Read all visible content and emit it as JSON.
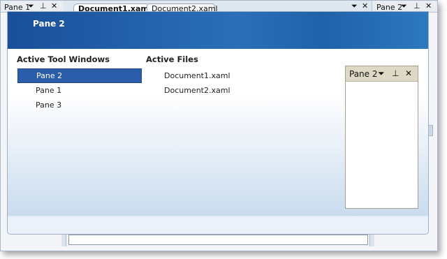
{
  "ide": {
    "left_tool": {
      "title": "Pane 1",
      "dropdown": "⏷",
      "pin": "⊥",
      "close": "✕"
    },
    "doc_tabs": [
      {
        "label": "Document1.xaml",
        "active": true
      },
      {
        "label": "Document2.xaml",
        "active": false
      }
    ],
    "tab_menu": "⏷",
    "tab_close": "✕",
    "right_tool": {
      "title": "Pane 2",
      "dropdown": "⏷",
      "pin": "⊥",
      "close": "✕"
    }
  },
  "navigator": {
    "title": "Pane 2",
    "tool_windows": {
      "heading": "Active Tool Windows",
      "items": [
        "Pane 2",
        "Pane 1",
        "Pane 3"
      ],
      "selected_index": 0
    },
    "files": {
      "heading": "Active Files",
      "items": [
        "Document1.xaml",
        "Document2.xaml"
      ]
    },
    "preview": {
      "title": "Pane 2",
      "dropdown": "⏷",
      "pin": "⊥",
      "close": "✕"
    }
  },
  "colors": {
    "header_blue": "#1a4f9a",
    "selection_blue": "#2c5daa",
    "preview_header": "#ded9c6"
  }
}
